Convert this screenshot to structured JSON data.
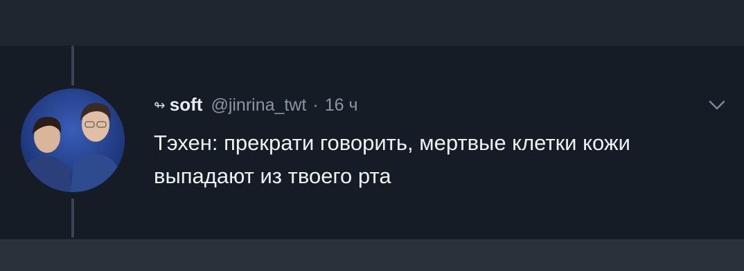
{
  "tweet": {
    "retweet_icon": "retweet-icon",
    "display_name": "soft",
    "handle": "@jinrina_twt",
    "separator": "·",
    "time": "16 ч",
    "text": "Тэхен: прекрати говорить, мертвые клетки кожи выпадают из твоего рта",
    "avatar": "avatar-photo",
    "menu_icon": "chevron-down-icon"
  },
  "colors": {
    "background": "#151c25",
    "name": "#e9edf1",
    "muted": "#8a96a3",
    "text": "#eef1f4"
  }
}
